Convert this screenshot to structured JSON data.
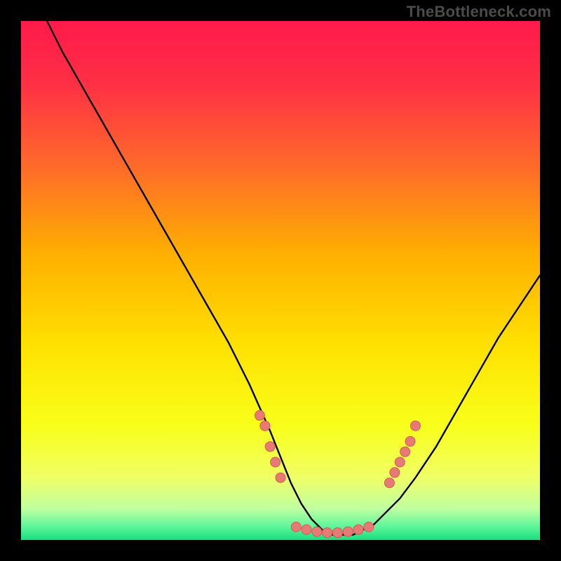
{
  "watermark": "TheBottleneck.com",
  "colors": {
    "gradient_stops": [
      {
        "offset": 0.0,
        "color": "#ff1a4b"
      },
      {
        "offset": 0.12,
        "color": "#ff2f45"
      },
      {
        "offset": 0.28,
        "color": "#ff6a2a"
      },
      {
        "offset": 0.45,
        "color": "#ffb000"
      },
      {
        "offset": 0.62,
        "color": "#ffe000"
      },
      {
        "offset": 0.78,
        "color": "#f8ff1a"
      },
      {
        "offset": 0.88,
        "color": "#f0ff66"
      },
      {
        "offset": 0.94,
        "color": "#bfffa0"
      },
      {
        "offset": 0.975,
        "color": "#5cf59a"
      },
      {
        "offset": 1.0,
        "color": "#18df7e"
      }
    ],
    "curve": "#000000",
    "dot_fill": "#e77a75",
    "dot_stroke": "#d55a55"
  },
  "chart_data": {
    "type": "line",
    "title": "",
    "xlabel": "",
    "ylabel": "",
    "xlim": [
      0,
      100
    ],
    "ylim": [
      0,
      100
    ],
    "series": [
      {
        "name": "curve",
        "x": [
          5,
          8,
          12,
          16,
          20,
          24,
          28,
          32,
          36,
          40,
          44,
          48,
          50,
          52,
          54,
          56,
          58,
          60,
          62,
          64,
          66,
          68,
          70,
          73,
          76,
          80,
          84,
          88,
          92,
          96,
          100
        ],
        "y": [
          100,
          94,
          87,
          80,
          73,
          66,
          59,
          52,
          45,
          38,
          30,
          21,
          16,
          11,
          7,
          4,
          2,
          1,
          1,
          1,
          2,
          3,
          5,
          8,
          12,
          18,
          25,
          32,
          39,
          45,
          51
        ]
      }
    ],
    "dots": {
      "left": {
        "x": [
          46,
          47,
          48,
          49,
          50
        ],
        "y": [
          24,
          22,
          18,
          15,
          12
        ]
      },
      "floor": {
        "x": [
          53,
          55,
          57,
          59,
          61,
          63,
          65,
          67
        ],
        "y": [
          2.5,
          2,
          1.6,
          1.4,
          1.4,
          1.6,
          2,
          2.5
        ]
      },
      "right": {
        "x": [
          71,
          72,
          73,
          74,
          75,
          76
        ],
        "y": [
          11,
          13,
          15,
          17,
          19,
          22
        ]
      }
    }
  }
}
